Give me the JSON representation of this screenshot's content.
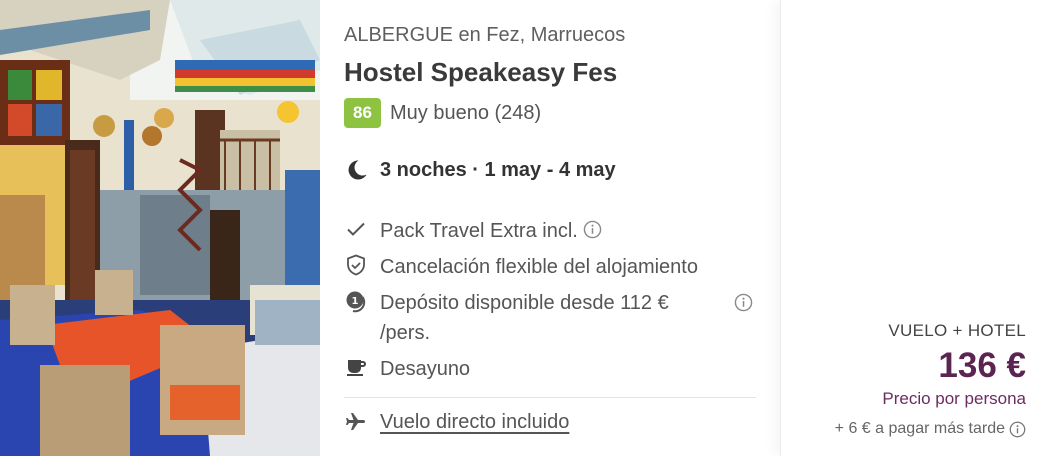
{
  "listing": {
    "type_line": "ALBERGUE en Fez, Marruecos",
    "name": "Hostel Speakeasy Fes",
    "rating": {
      "score": "86",
      "text": "Muy bueno (248)",
      "badge_color": "#8dc341"
    },
    "stay": "3 noches · 1 may - 4 may",
    "features": [
      {
        "icon": "check-icon",
        "text": "Pack Travel Extra incl.",
        "info": true
      },
      {
        "icon": "shield-check-icon",
        "text": "Cancelación flexible del alojamiento",
        "info": false
      },
      {
        "icon": "deposit-coin-icon",
        "text": "Depósito disponible desde 112 € /pers.",
        "info": true
      },
      {
        "icon": "coffee-cup-icon",
        "text": "Desayuno",
        "info": false
      }
    ],
    "flight_link": "Vuelo directo incluido"
  },
  "price_panel": {
    "package_label": "VUELO + HOTEL",
    "price": "136 €",
    "per_person": "Precio por persona",
    "pay_later": "+ 6 € a pagar más tarde",
    "price_color": "#5b2551"
  }
}
